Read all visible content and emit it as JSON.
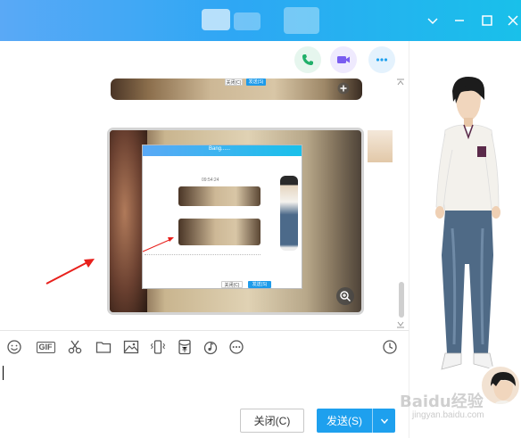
{
  "window": {
    "controls": [
      "chevron-down-icon",
      "minimize-icon",
      "maximize-icon",
      "close-icon"
    ],
    "title_bar_gradient": [
      "#5aa9f6",
      "#19c0ea"
    ]
  },
  "call_buttons": {
    "phone_icon": "phone-icon",
    "video_icon": "video-icon",
    "more_icon": "more-icon",
    "colors": {
      "phone": "#21b06a",
      "video": "#7a5cf0",
      "more": "#1ea0ee"
    }
  },
  "inner_screenshot": {
    "title": "Bang......",
    "time": "09:54:24",
    "close_label": "关闭(C)",
    "send_label": "发送(S)"
  },
  "toolbar": {
    "gif_label": "GIF",
    "icons": [
      "emoji-icon",
      "gif-icon",
      "scissors-icon",
      "folder-icon",
      "image-icon",
      "shake-icon",
      "red-packet-icon",
      "music-icon",
      "more-icon",
      "history-icon"
    ]
  },
  "buttons": {
    "close_label": "关闭(C)",
    "send_label": "发送(S)"
  },
  "watermark": {
    "text": "Baidu经验",
    "sub": "jingyan.baidu.com"
  },
  "accent_color": "#1ea0ee",
  "annotation_color": "#e8201c"
}
